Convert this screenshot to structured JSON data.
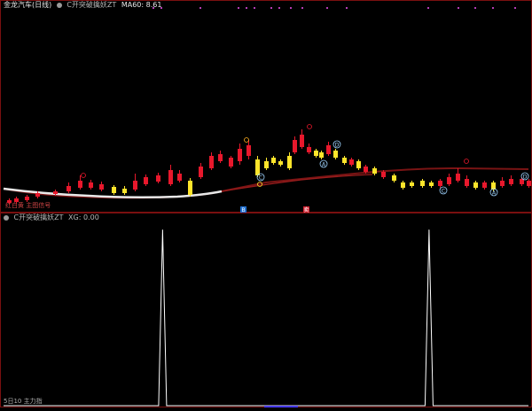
{
  "header": {
    "title": "金龙汽车(日线)",
    "indicator_name": "C开突破擒妖ZT",
    "ma_label": "MA60: 8.61"
  },
  "subchart_header": {
    "indicator": "C开突破擒妖ZT",
    "value_label": "XG: 0.00"
  },
  "legend_label": "红白黄 主图信号",
  "bottom_label": "5日10 主力指",
  "buy_tag": "B",
  "sell_tag": "卖",
  "signal_labels": [
    "C",
    "A",
    "D"
  ],
  "colors": {
    "up": "#e8182c",
    "down": "#ffe52b",
    "ma_white": "#e8e8e8",
    "ma_dark_red": "#7a1414",
    "border": "#7a0f0f",
    "signal": "#9fd4ff",
    "pulse": "#ffffff"
  },
  "chart_data": {
    "type": "line",
    "series": [
      {
        "values": [
          0,
          0,
          0,
          0,
          0,
          0,
          0,
          0,
          0,
          0,
          0,
          0,
          0,
          0,
          0,
          0,
          0,
          0,
          0,
          0,
          0,
          0,
          0,
          0,
          0,
          0,
          0,
          0,
          0,
          0,
          0,
          0,
          0,
          0,
          0,
          0,
          0,
          0,
          0,
          0,
          1,
          0,
          0,
          0,
          0,
          0,
          0,
          0,
          0,
          0,
          0,
          0,
          0,
          0,
          0,
          0,
          0,
          0,
          0,
          0,
          0,
          0,
          0,
          0,
          0,
          0,
          0,
          0,
          0,
          0,
          0,
          0,
          0,
          0,
          0,
          0,
          0,
          0,
          0,
          0,
          0,
          0,
          0,
          0,
          0,
          0,
          0,
          0,
          0,
          0,
          0,
          0,
          0,
          0,
          0,
          0,
          0,
          0,
          0,
          0,
          0,
          0,
          0,
          0,
          0,
          0,
          0,
          1,
          0,
          0,
          0,
          0,
          0,
          0,
          0,
          0,
          0,
          0,
          0,
          0,
          0,
          0,
          0,
          0,
          0,
          0,
          0,
          0,
          0,
          0,
          0,
          0,
          0
        ]
      }
    ],
    "ylim": [
      0,
      1.05
    ]
  }
}
